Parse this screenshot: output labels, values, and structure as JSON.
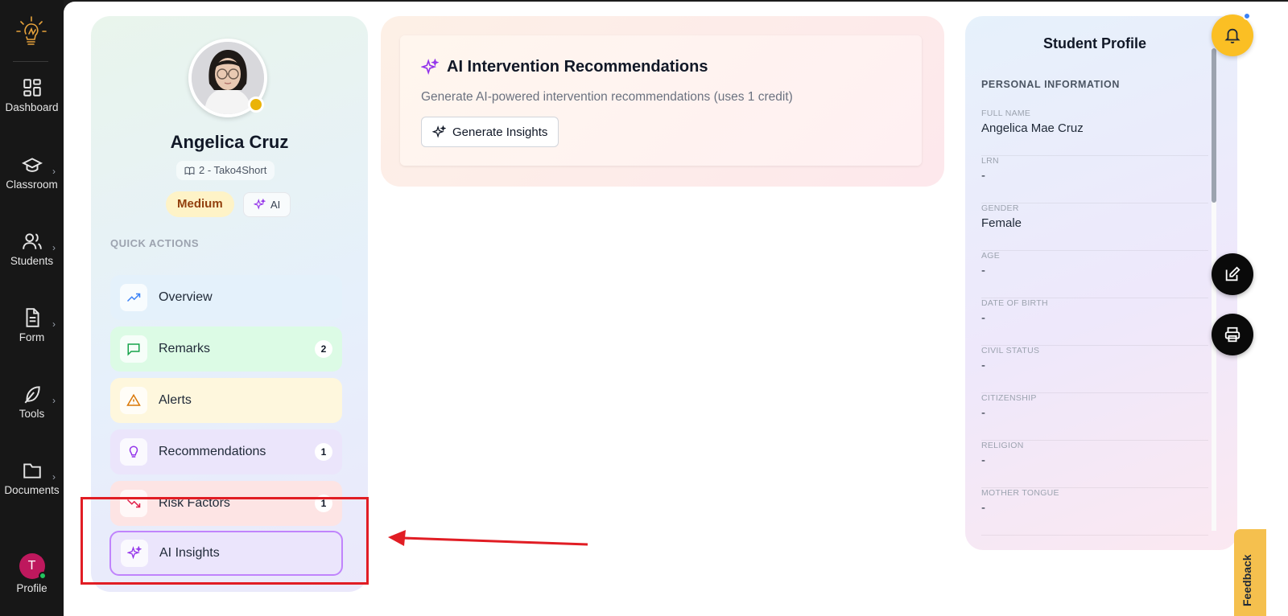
{
  "nav": {
    "items": [
      {
        "label": "Dashboard",
        "icon": "dashboard-icon",
        "chevron": ""
      },
      {
        "label": "Classroom",
        "icon": "graduation-cap-icon",
        "chevron": "›"
      },
      {
        "label": "Students",
        "icon": "users-icon",
        "chevron": "›"
      },
      {
        "label": "Form",
        "icon": "document-icon",
        "chevron": "›"
      },
      {
        "label": "Tools",
        "icon": "feather-icon",
        "chevron": "›"
      },
      {
        "label": "Documents",
        "icon": "folder-icon",
        "chevron": "›"
      }
    ],
    "profile": {
      "initial": "T",
      "label": "Profile"
    }
  },
  "student": {
    "name": "Angelica Cruz",
    "section": "2 - Tako4Short",
    "risk_level": "Medium",
    "ai_chip": "AI"
  },
  "quick_actions": {
    "title": "QUICK ACTIONS",
    "items": {
      "overview": {
        "label": "Overview",
        "badge": ""
      },
      "remarks": {
        "label": "Remarks",
        "badge": "2"
      },
      "alerts": {
        "label": "Alerts",
        "badge": ""
      },
      "recommendations": {
        "label": "Recommendations",
        "badge": "1"
      },
      "risk_factors": {
        "label": "Risk Factors",
        "badge": "1"
      },
      "ai_insights": {
        "label": "AI Insights",
        "badge": ""
      }
    }
  },
  "ai_recommendations": {
    "title": "AI Intervention Recommendations",
    "description": "Generate AI-powered intervention recommendations (uses 1 credit)",
    "button": "Generate Insights"
  },
  "student_profile": {
    "title": "Student Profile",
    "section_title": "PERSONAL INFORMATION",
    "fields": [
      {
        "key": "FULL NAME",
        "value": "Angelica Mae Cruz"
      },
      {
        "key": "LRN",
        "value": "-"
      },
      {
        "key": "GENDER",
        "value": "Female"
      },
      {
        "key": "AGE",
        "value": "-"
      },
      {
        "key": "DATE OF BIRTH",
        "value": "-"
      },
      {
        "key": "CIVIL STATUS",
        "value": "-"
      },
      {
        "key": "CITIZENSHIP",
        "value": "-"
      },
      {
        "key": "RELIGION",
        "value": "-"
      },
      {
        "key": "MOTHER TONGUE",
        "value": "-"
      }
    ]
  },
  "feedback": {
    "label": "Feedback"
  },
  "colors": {
    "accent_purple": "#9333ea",
    "risk_medium_bg": "#fef3c7",
    "annotation_red": "#e11d24",
    "bell": "#fbbf24"
  }
}
